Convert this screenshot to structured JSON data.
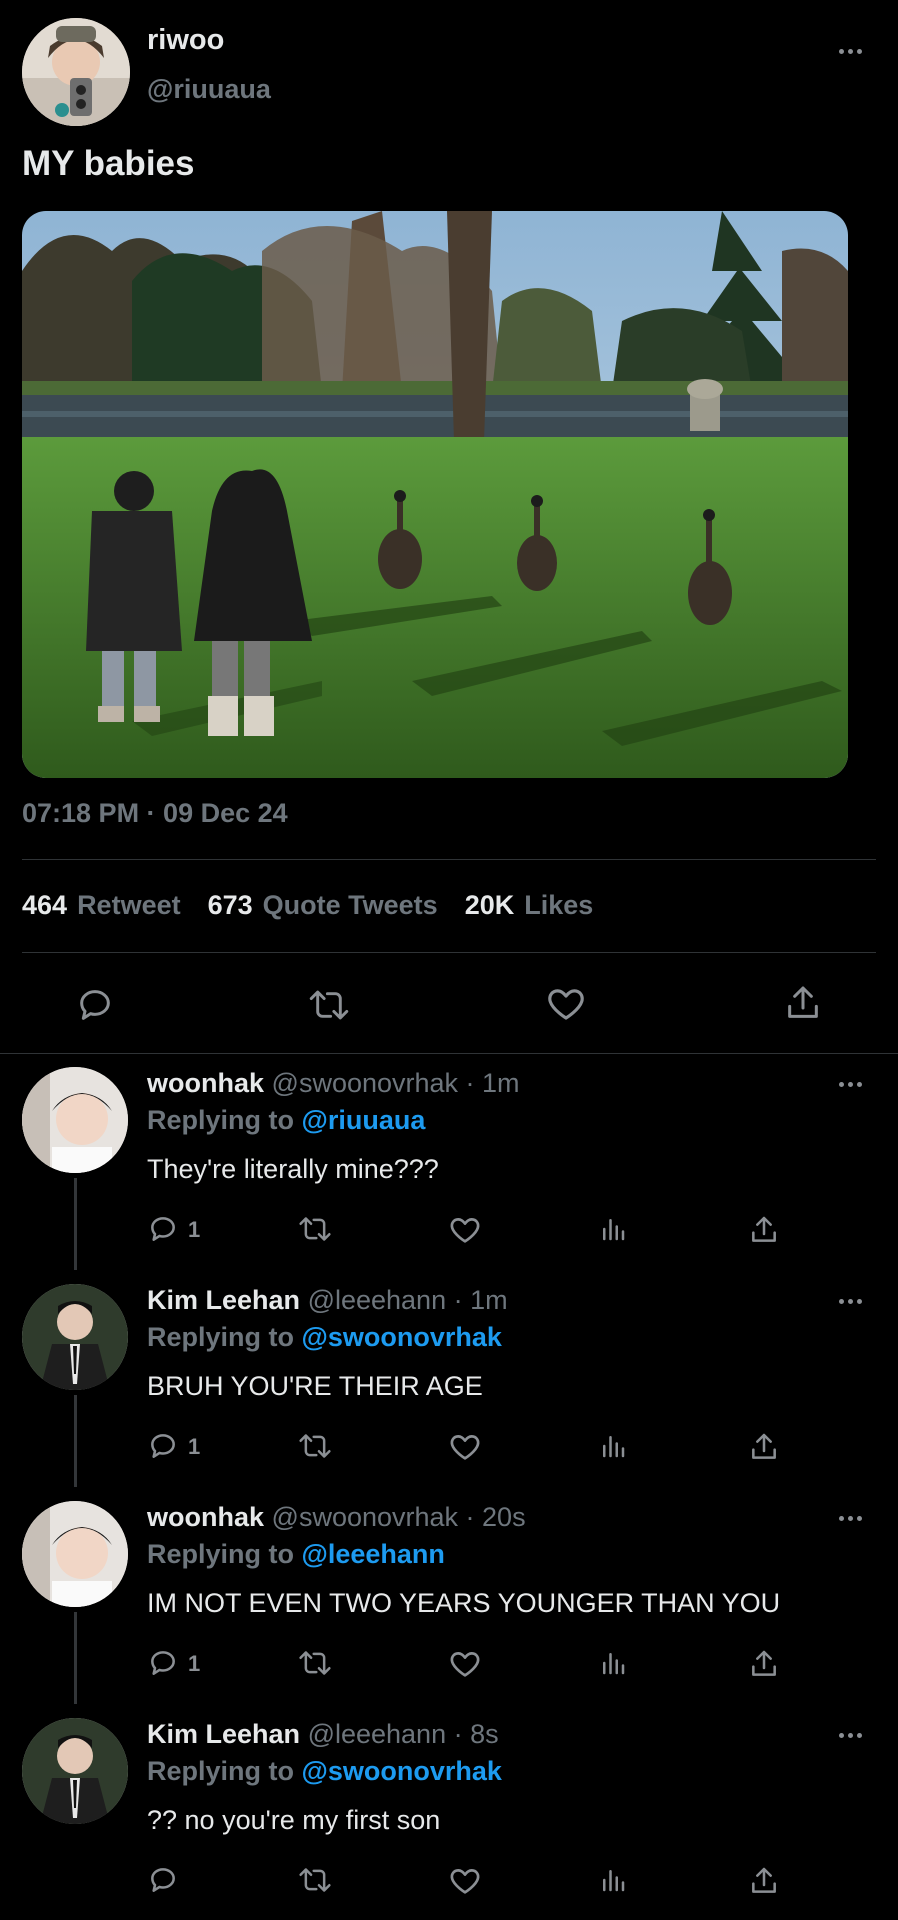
{
  "tweet": {
    "display_name": "riwoo",
    "handle": "@riuuaua",
    "text": "MY babies",
    "timestamp": "07:18 PM · 09 Dec 24",
    "stats": [
      {
        "number": "464",
        "label": "Retweet"
      },
      {
        "number": "673",
        "label": "Quote Tweets"
      },
      {
        "number": "20K",
        "label": "Likes"
      }
    ],
    "actions": [
      "reply-icon",
      "retweet-icon",
      "like-icon",
      "share-icon"
    ]
  },
  "replies": [
    {
      "name": "woonhak",
      "handle": "@swoonovrhak",
      "time": "· 1m",
      "replying_prefix": "Replying to",
      "replying_to": "@riuuaua",
      "text": "They're literally mine???",
      "reply_count": "1"
    },
    {
      "name": "Kim Leehan",
      "handle": "@leeehann",
      "time": "· 1m",
      "replying_prefix": "Replying to",
      "replying_to": "@swoonovrhak",
      "text": "BRUH YOU'RE THEIR AGE",
      "reply_count": "1"
    },
    {
      "name": "woonhak",
      "handle": "@swoonovrhak",
      "time": "· 20s",
      "replying_prefix": "Replying to",
      "replying_to": "@leeehann",
      "text": "IM NOT EVEN TWO YEARS YOUNGER THAN YOU",
      "reply_count": "1"
    },
    {
      "name": "Kim Leehan",
      "handle": "@leeehann",
      "time": "· 8s",
      "replying_prefix": "Replying to",
      "replying_to": "@swoonovrhak",
      "text": "?? no you're my first son",
      "reply_count": ""
    }
  ],
  "colors": {
    "background": "#000000",
    "text": "#e7e9ea",
    "muted": "#6e767d",
    "link": "#1d9bf0",
    "divider": "#2f3336"
  }
}
